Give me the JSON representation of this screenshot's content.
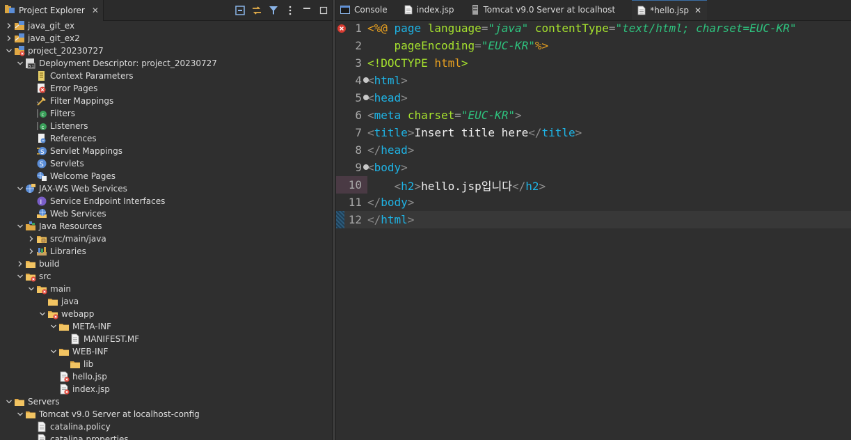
{
  "explorer": {
    "title": "Project Explorer",
    "tools": [
      "collapse-all-icon",
      "link-with-editor-icon",
      "filter-icon",
      "view-menu-icon",
      "minimize-icon",
      "maximize-icon"
    ],
    "tree": [
      {
        "label": "java_git_ex",
        "depth": 0,
        "twisty": "closed",
        "icon": "project"
      },
      {
        "label": "java_git_ex2",
        "depth": 0,
        "twisty": "closed",
        "icon": "project"
      },
      {
        "label": "project_20230727",
        "depth": 0,
        "twisty": "open",
        "icon": "project-error"
      },
      {
        "label": "Deployment Descriptor: project_20230727",
        "depth": 1,
        "twisty": "open",
        "icon": "descriptor"
      },
      {
        "label": "Context Parameters",
        "depth": 2,
        "twisty": "",
        "icon": "ctx"
      },
      {
        "label": "Error Pages",
        "depth": 2,
        "twisty": "",
        "icon": "error-page"
      },
      {
        "label": "Filter Mappings",
        "depth": 2,
        "twisty": "",
        "icon": "filter-map"
      },
      {
        "label": "Filters",
        "depth": 2,
        "twisty": "",
        "icon": "filter"
      },
      {
        "label": "Listeners",
        "depth": 2,
        "twisty": "",
        "icon": "listener"
      },
      {
        "label": "References",
        "depth": 2,
        "twisty": "",
        "icon": "ref"
      },
      {
        "label": "Servlet Mappings",
        "depth": 2,
        "twisty": "",
        "icon": "servlet-map"
      },
      {
        "label": "Servlets",
        "depth": 2,
        "twisty": "",
        "icon": "servlet"
      },
      {
        "label": "Welcome Pages",
        "depth": 2,
        "twisty": "",
        "icon": "welcome"
      },
      {
        "label": "JAX-WS Web Services",
        "depth": 1,
        "twisty": "open",
        "icon": "jaxws"
      },
      {
        "label": "Service Endpoint Interfaces",
        "depth": 2,
        "twisty": "",
        "icon": "sei"
      },
      {
        "label": "Web Services",
        "depth": 2,
        "twisty": "",
        "icon": "ws"
      },
      {
        "label": "Java Resources",
        "depth": 1,
        "twisty": "open",
        "icon": "javares"
      },
      {
        "label": "src/main/java",
        "depth": 2,
        "twisty": "closed",
        "icon": "pkg-folder"
      },
      {
        "label": "Libraries",
        "depth": 2,
        "twisty": "closed",
        "icon": "libs"
      },
      {
        "label": "build",
        "depth": 1,
        "twisty": "closed",
        "icon": "folder"
      },
      {
        "label": "src",
        "depth": 1,
        "twisty": "open",
        "icon": "folder-error"
      },
      {
        "label": "main",
        "depth": 2,
        "twisty": "open",
        "icon": "folder-error"
      },
      {
        "label": "java",
        "depth": 3,
        "twisty": "",
        "icon": "folder"
      },
      {
        "label": "webapp",
        "depth": 3,
        "twisty": "open",
        "icon": "folder-error"
      },
      {
        "label": "META-INF",
        "depth": 4,
        "twisty": "open",
        "icon": "folder"
      },
      {
        "label": "MANIFEST.MF",
        "depth": 5,
        "twisty": "",
        "icon": "file"
      },
      {
        "label": "WEB-INF",
        "depth": 4,
        "twisty": "open",
        "icon": "folder"
      },
      {
        "label": "lib",
        "depth": 5,
        "twisty": "",
        "icon": "folder"
      },
      {
        "label": "hello.jsp",
        "depth": 4,
        "twisty": "",
        "icon": "jsp-error"
      },
      {
        "label": "index.jsp",
        "depth": 4,
        "twisty": "",
        "icon": "jsp-error"
      },
      {
        "label": "Servers",
        "depth": 0,
        "twisty": "open",
        "icon": "folder"
      },
      {
        "label": "Tomcat v9.0 Server at localhost-config",
        "depth": 1,
        "twisty": "open",
        "icon": "folder"
      },
      {
        "label": "catalina.policy",
        "depth": 2,
        "twisty": "",
        "icon": "file"
      },
      {
        "label": "catalina.properties",
        "depth": 2,
        "twisty": "",
        "icon": "file"
      }
    ]
  },
  "editor": {
    "tabs": [
      {
        "label": "Console",
        "icon": "console-icon",
        "active": false
      },
      {
        "label": "index.jsp",
        "icon": "jsp-file-icon",
        "active": false
      },
      {
        "label": "Tomcat v9.0 Server at localhost",
        "icon": "server-icon",
        "active": false
      },
      {
        "label": "*hello.jsp",
        "icon": "jsp-file-icon",
        "active": true
      }
    ],
    "close_glyph": "✕",
    "lines": [
      {
        "n": "1",
        "fold": false,
        "err": true,
        "hl": false,
        "qd": false,
        "current": false,
        "tokens": [
          [
            "<%@",
            "d"
          ],
          [
            " ",
            "w"
          ],
          [
            "page",
            "t"
          ],
          [
            " ",
            "w"
          ],
          [
            "language",
            "k"
          ],
          [
            "=",
            "p"
          ],
          [
            "\"java\"",
            "s"
          ],
          [
            " ",
            "w"
          ],
          [
            "contentType",
            "k"
          ],
          [
            "=",
            "p"
          ],
          [
            "\"text/html; charset=EUC-KR\"",
            "s"
          ]
        ]
      },
      {
        "n": "2",
        "fold": false,
        "err": false,
        "hl": false,
        "qd": false,
        "current": false,
        "tokens": [
          [
            "    ",
            "w"
          ],
          [
            "pageEncoding",
            "k"
          ],
          [
            "=",
            "p"
          ],
          [
            "\"EUC-KR\"",
            "s"
          ],
          [
            "%>",
            "d"
          ]
        ]
      },
      {
        "n": "3",
        "fold": false,
        "err": false,
        "hl": false,
        "qd": false,
        "current": false,
        "tokens": [
          [
            "<!DOCTYPE",
            "k"
          ],
          [
            " ",
            "w"
          ],
          [
            "html",
            "dir"
          ],
          [
            ">",
            "k"
          ]
        ]
      },
      {
        "n": "4",
        "fold": true,
        "err": false,
        "hl": false,
        "qd": false,
        "current": false,
        "tokens": [
          [
            "<",
            "p"
          ],
          [
            "html",
            "t"
          ],
          [
            ">",
            "p"
          ]
        ]
      },
      {
        "n": "5",
        "fold": true,
        "err": false,
        "hl": false,
        "qd": false,
        "current": false,
        "tokens": [
          [
            "<",
            "p"
          ],
          [
            "head",
            "t"
          ],
          [
            ">",
            "p"
          ]
        ]
      },
      {
        "n": "6",
        "fold": false,
        "err": false,
        "hl": false,
        "qd": false,
        "current": false,
        "tokens": [
          [
            "<",
            "p"
          ],
          [
            "meta",
            "t"
          ],
          [
            " ",
            "w"
          ],
          [
            "charset",
            "k"
          ],
          [
            "=",
            "p"
          ],
          [
            "\"EUC-KR\"",
            "s"
          ],
          [
            ">",
            "p"
          ]
        ]
      },
      {
        "n": "7",
        "fold": false,
        "err": false,
        "hl": false,
        "qd": false,
        "current": false,
        "tokens": [
          [
            "<",
            "p"
          ],
          [
            "title",
            "t"
          ],
          [
            ">",
            "p"
          ],
          [
            "Insert title here",
            "w"
          ],
          [
            "</",
            "p"
          ],
          [
            "title",
            "t"
          ],
          [
            ">",
            "p"
          ]
        ]
      },
      {
        "n": "8",
        "fold": false,
        "err": false,
        "hl": false,
        "qd": false,
        "current": false,
        "tokens": [
          [
            "</",
            "p"
          ],
          [
            "head",
            "t"
          ],
          [
            ">",
            "p"
          ]
        ]
      },
      {
        "n": "9",
        "fold": true,
        "err": false,
        "hl": false,
        "qd": false,
        "current": false,
        "tokens": [
          [
            "<",
            "p"
          ],
          [
            "body",
            "t"
          ],
          [
            ">",
            "p"
          ]
        ]
      },
      {
        "n": "10",
        "fold": false,
        "err": false,
        "hl": true,
        "qd": false,
        "current": false,
        "tokens": [
          [
            "    ",
            "w"
          ],
          [
            "<",
            "p"
          ],
          [
            "h2",
            "t"
          ],
          [
            ">",
            "p"
          ],
          [
            "hello.jsp입니다",
            "w"
          ],
          [
            "</",
            "p"
          ],
          [
            "h2",
            "t"
          ],
          [
            ">",
            "p"
          ]
        ]
      },
      {
        "n": "11",
        "fold": false,
        "err": false,
        "hl": false,
        "qd": false,
        "current": false,
        "tokens": [
          [
            "</",
            "p"
          ],
          [
            "body",
            "t"
          ],
          [
            ">",
            "p"
          ]
        ]
      },
      {
        "n": "12",
        "fold": false,
        "err": false,
        "hl": false,
        "qd": true,
        "current": true,
        "tokens": [
          [
            "</",
            "p"
          ],
          [
            "html",
            "t"
          ],
          [
            ">",
            "p"
          ]
        ]
      }
    ]
  }
}
